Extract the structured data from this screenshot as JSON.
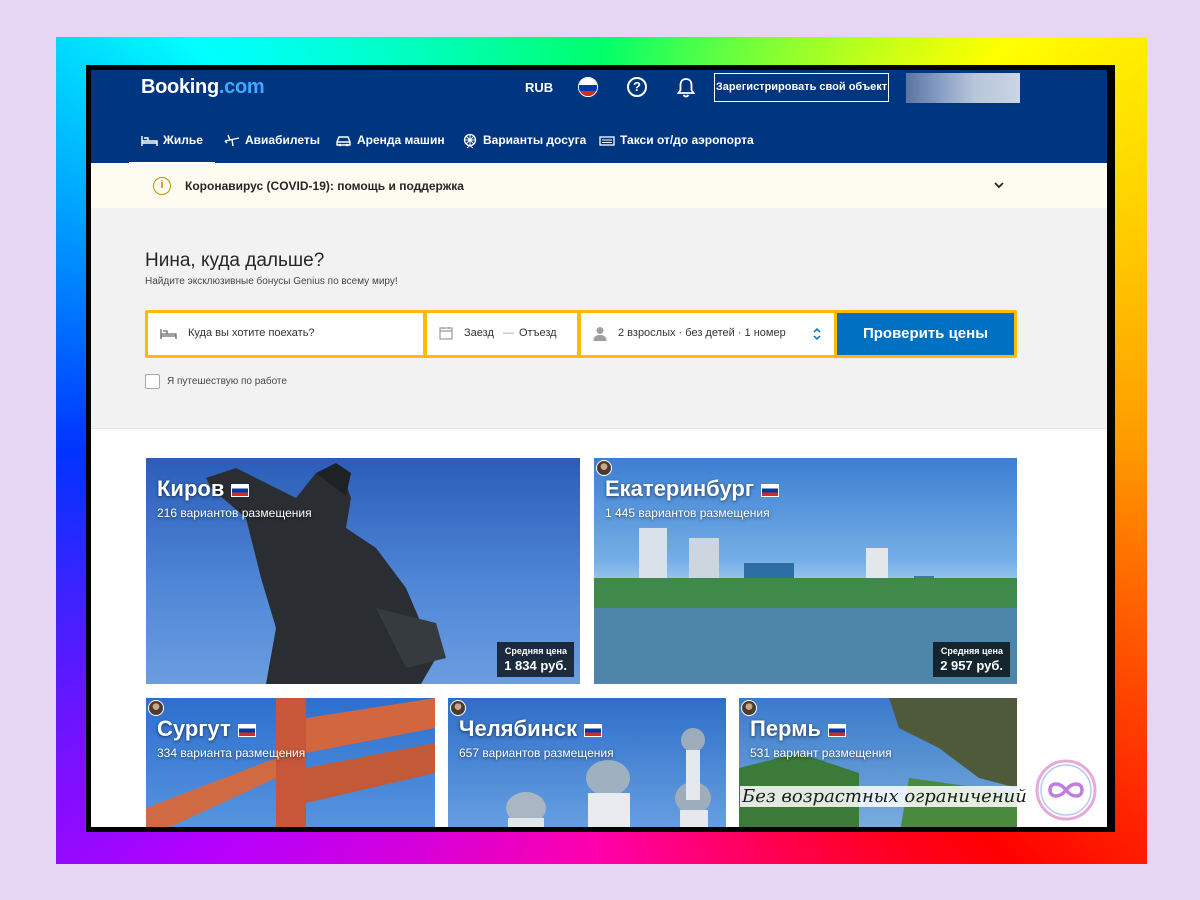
{
  "header": {
    "logo_main": "Booking",
    "logo_suffix": ".com",
    "currency": "RUB",
    "help_glyph": "?",
    "register_label": "Зарегистрировать свой объект"
  },
  "nav": {
    "items": [
      {
        "label": "Жилье",
        "icon": "bed-icon",
        "active": true
      },
      {
        "label": "Авиабилеты",
        "icon": "plane-icon"
      },
      {
        "label": "Аренда машин",
        "icon": "car-icon"
      },
      {
        "label": "Варианты досуга",
        "icon": "attractions-icon"
      },
      {
        "label": "Такси от/до аэропорта",
        "icon": "taxi-icon"
      }
    ]
  },
  "banner": {
    "info_glyph": "i",
    "text": "Коронавирус (COVID-19): помощь и поддержка"
  },
  "search": {
    "greeting": "Нина, куда дальше?",
    "subtitle": "Найдите эксклюзивные бонусы Genius по всему миру!",
    "destination_placeholder": "Куда вы хотите поехать?",
    "checkin": "Заезд",
    "date_separator": "—",
    "checkout": "Отъезд",
    "guests": "2 взрослых · без детей · 1 номер",
    "submit_label": "Проверить цены",
    "work_trip_label": "Я путешествую по работе"
  },
  "destinations": [
    {
      "city": "Киров",
      "count": "216 вариантов размещения",
      "price_label": "Средняя цена",
      "price": "1 834 руб."
    },
    {
      "city": "Екатеринбург",
      "count": "1 445 вариантов размещения",
      "price_label": "Средняя цена",
      "price": "2 957 руб."
    },
    {
      "city": "Сургут",
      "count": "334 варианта размещения"
    },
    {
      "city": "Челябинск",
      "count": "657 вариантов размещения"
    },
    {
      "city": "Пермь",
      "count": "531 вариант размещения"
    }
  ],
  "watermark": {
    "text": "Без возрастных ограничений"
  },
  "colors": {
    "brand": "#003580",
    "accent_button": "#0071c2",
    "searchbar_border": "#febb02",
    "banner_bg": "#fefbf0"
  }
}
